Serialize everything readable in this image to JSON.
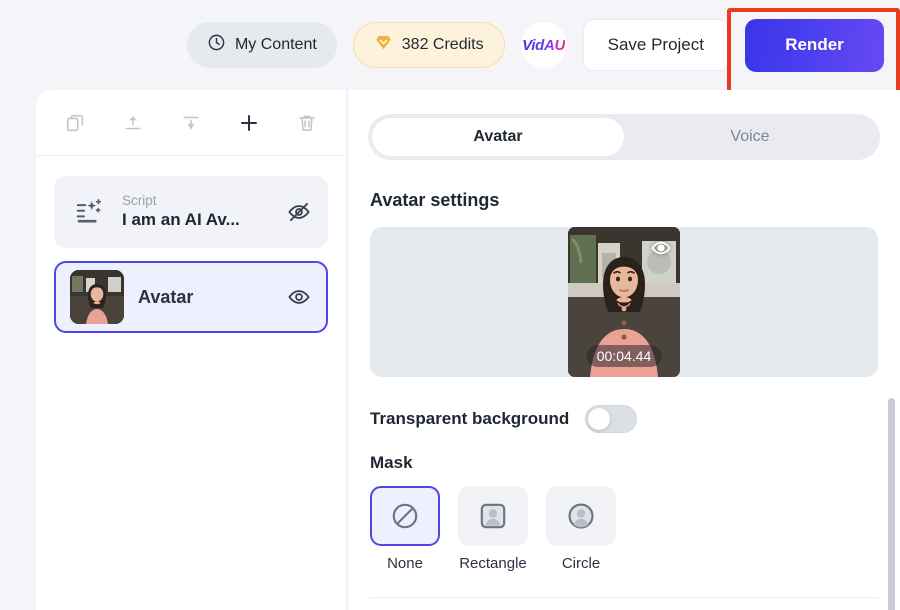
{
  "header": {
    "my_content_label": "My Content",
    "credits_label": "382 Credits",
    "brand": "VidAU",
    "save_label": "Save Project",
    "render_label": "Render",
    "highlight_color": "#ec3c1f",
    "render_gradient_start": "#3b34e8",
    "render_gradient_end": "#6a48f2"
  },
  "left_panel": {
    "toolbar": [
      {
        "name": "duplicate-icon",
        "label": "Duplicate"
      },
      {
        "name": "move-to-top-icon",
        "label": "Move to top"
      },
      {
        "name": "move-to-bottom-icon",
        "label": "Move to bottom"
      },
      {
        "name": "add-icon",
        "label": "Add"
      },
      {
        "name": "delete-icon",
        "label": "Delete"
      }
    ],
    "layers": [
      {
        "kind": "Script",
        "title": "I am an AI Av...",
        "visible": false,
        "selected": false
      },
      {
        "name": "Avatar",
        "visible": true,
        "selected": true
      }
    ]
  },
  "right_panel": {
    "tabs": [
      {
        "label": "Avatar",
        "active": true
      },
      {
        "label": "Voice",
        "active": false
      }
    ],
    "section_title": "Avatar settings",
    "preview": {
      "duration": "00:04.44",
      "eye_icon": "eye-icon"
    },
    "transparent_background": {
      "label": "Transparent background",
      "enabled": false
    },
    "mask": {
      "label": "Mask",
      "options": [
        {
          "label": "None",
          "icon": "no-mask-icon",
          "selected": true
        },
        {
          "label": "Rectangle",
          "icon": "rectangle-mask-icon",
          "selected": false
        },
        {
          "label": "Circle",
          "icon": "circle-mask-icon",
          "selected": false
        }
      ]
    }
  },
  "colors": {
    "accent": "#4f46e5",
    "page_bg": "#f4f4f9",
    "panel_bg": "#ffffff"
  }
}
